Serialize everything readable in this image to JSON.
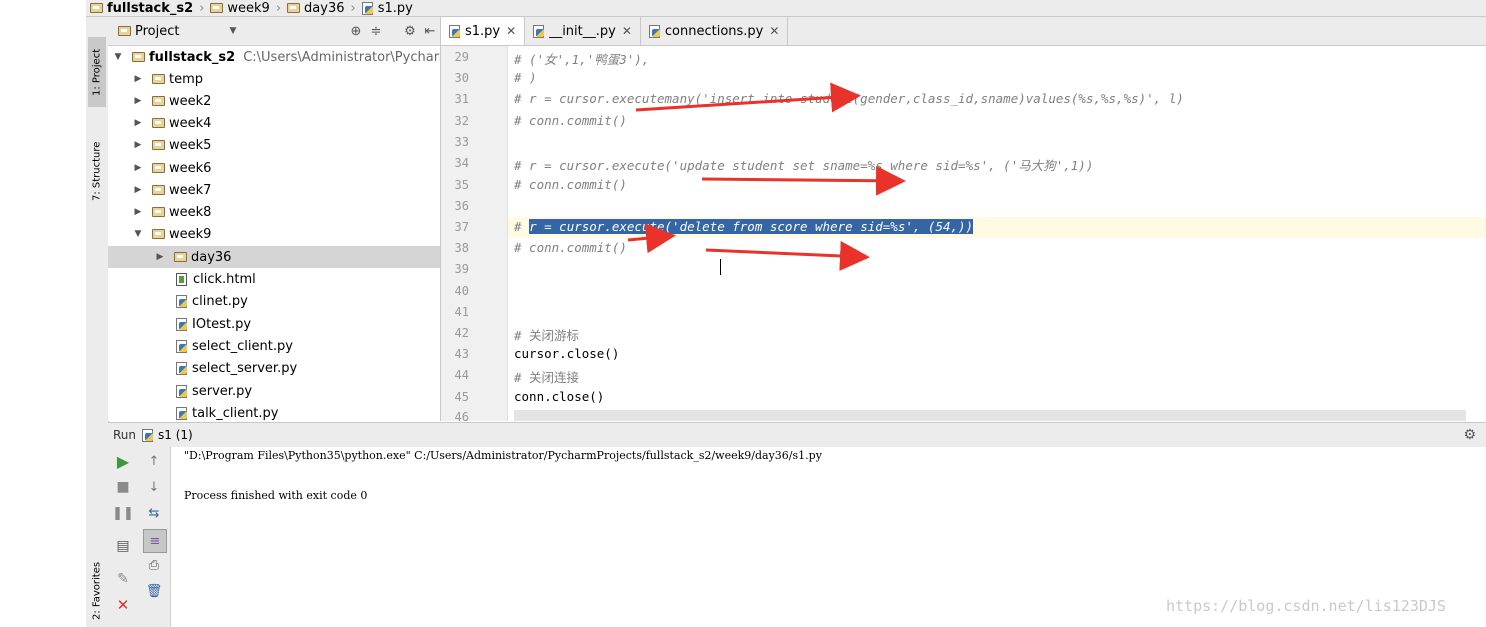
{
  "breadcrumb": [
    "fullstack_s2",
    "week9",
    "day36",
    "s1.py"
  ],
  "toolstrip": {
    "project_tab": "1: Project",
    "structure_tab": "7: Structure",
    "favorites_tab": "2: Favorites"
  },
  "project_panel": {
    "title": "Project",
    "root": {
      "name": "fullstack_s2",
      "path": "C:\\Users\\Administrator\\PycharmP"
    },
    "folders": [
      "temp",
      "week2",
      "week4",
      "week5",
      "week6",
      "week7",
      "week8",
      "week9"
    ],
    "selected_folder": "day36",
    "files": [
      "click.html",
      "clinet.py",
      "IOtest.py",
      "select_client.py",
      "select_server.py",
      "server.py",
      "talk_client.py"
    ]
  },
  "editor": {
    "tabs": [
      {
        "label": "s1.py",
        "active": true
      },
      {
        "label": "__init__.py",
        "active": false
      },
      {
        "label": "connections.py",
        "active": false
      }
    ],
    "line_numbers": [
      "29",
      "30",
      "31",
      "32",
      "33",
      "34",
      "35",
      "36",
      "37",
      "38",
      "39",
      "40",
      "41",
      "42",
      "43",
      "44",
      "45",
      "46"
    ],
    "lines": [
      "# ('女',1,'鸭蛋3'),",
      "# )",
      "# r = cursor.executemany('insert into student(gender,class_id,sname)values(%s,%s,%s)', l)",
      "# conn.commit()",
      "",
      "# r = cursor.execute('update student set sname=%s where sid=%s', ('马大狗',1))",
      "# conn.commit()",
      "",
      "r = cursor.execute('delete from score where sid=%s', (54,))",
      "# conn.commit()",
      "",
      "",
      "",
      "# 关闭游标",
      "cursor.close()",
      "# 关闭连接",
      "conn.close()",
      ""
    ],
    "line37_prefix": "# "
  },
  "run_panel": {
    "label": "Run",
    "config": "s1 (1)",
    "output": [
      "\"D:\\Program Files\\Python35\\python.exe\" C:/Users/Administrator/PycharmProjects/fullstack_s2/week9/day36/s1.py",
      "",
      "Process finished with exit code 0"
    ]
  },
  "watermark": "https://blog.csdn.net/lis123DJS",
  "colors": {
    "selection": "#3465a4",
    "arrow": "#e8322a",
    "run_green": "#3c9a3c",
    "stop_red": "#d8362f"
  }
}
